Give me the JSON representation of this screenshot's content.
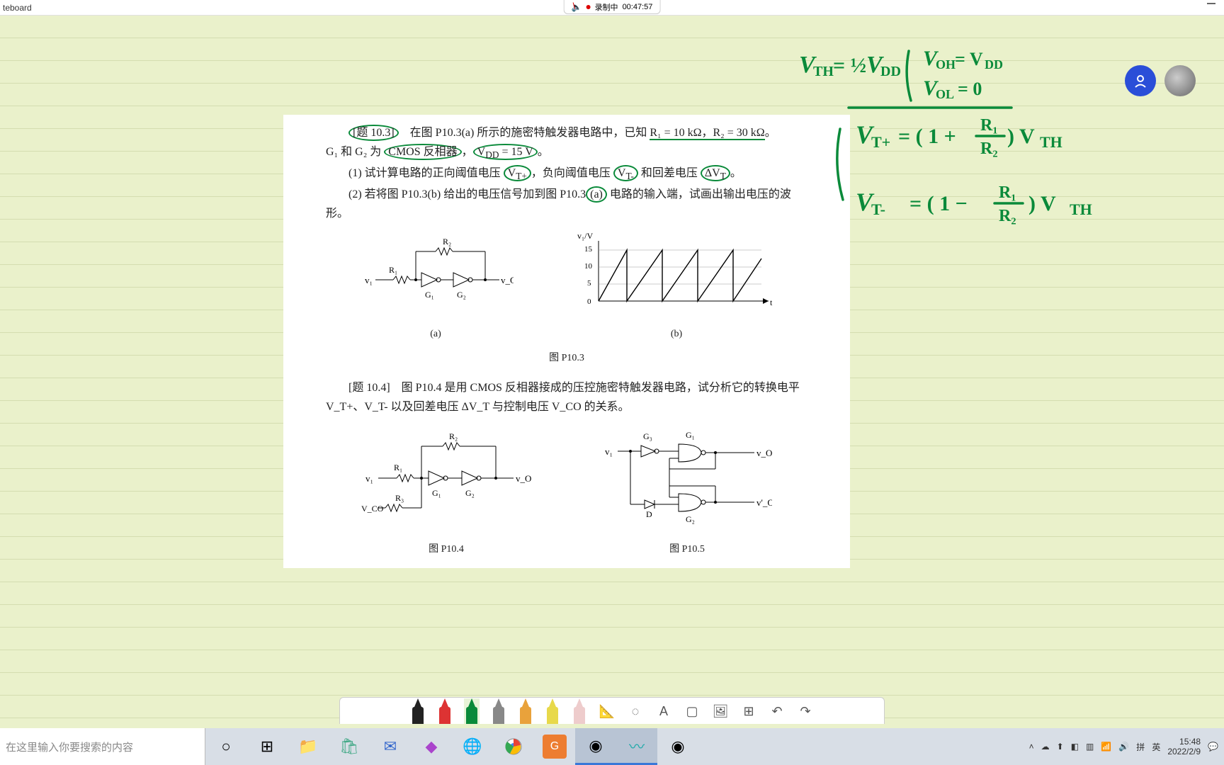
{
  "titlebar": {
    "title": "teboard"
  },
  "recording": {
    "audio_status": "muted",
    "label": "录制中",
    "time": "00:47:57"
  },
  "document": {
    "p103": {
      "intro": "[题 10.3]　在图 P10.3(a) 所示的施密特触发器电路中，已知 R₁ = 10 kΩ，R₂ = 30 kΩ。",
      "line2": "G₁ 和 G₂ 为 CMOS 反相器，V_DD = 15 V。",
      "item1": "(1) 试计算电路的正向阈值电压 V_T+，负向阈值电压 V_T- 和回差电压 ΔV_T。",
      "item2": "(2) 若将图 P10.3(b) 给出的电压信号加到图 P10.3(a) 电路的输入端，试画出输出电压的波形。",
      "fig_a": "(a)",
      "fig_b": "(b)",
      "caption": "图 P10.3",
      "circuit_labels": {
        "r1": "R₁",
        "r2": "R₂",
        "vi": "v₁",
        "vo": "v_O",
        "g1": "G₁",
        "g2": "G₂"
      },
      "wave": {
        "ylabel": "v₁/V",
        "xlabel": "t",
        "yticks": [
          "15",
          "10",
          "5",
          "0"
        ]
      }
    },
    "p104": {
      "intro": "[题 10.4]　图 P10.4 是用 CMOS 反相器接成的压控施密特触发器电路，试分析它的转换电平 V_T+、V_T- 以及回差电压 ΔV_T 与控制电压 V_CO 的关系。",
      "caption4": "图 P10.4",
      "caption5": "图 P10.5",
      "circuit4": {
        "r1": "R₁",
        "r2": "R₂",
        "r3": "R₃",
        "vi": "v₁",
        "vo": "v_O",
        "vco": "V_CO",
        "g1": "G₁",
        "g2": "G₂"
      },
      "circuit5": {
        "vi": "v₁",
        "vo": "v_O",
        "vo2": "v'_O",
        "g1": "G₁",
        "g2": "G₂",
        "g3": "G₃",
        "d": "D"
      }
    }
  },
  "handwriting": {
    "line1a": "V_TH = ½ V_DD",
    "line1b1": "V_OH = V_DD",
    "line1b2": "V_OL = 0",
    "line2": "V_T+ = (1 + R₁/R₂) V_TH",
    "line3": "V_T- = (1 − R₁/R₂) V_TH"
  },
  "toolbar": {
    "pens": [
      "black",
      "red",
      "green-active",
      "gray",
      "orange",
      "highlighter",
      "eraser",
      "ruler",
      "lasso",
      "text",
      "screen",
      "image",
      "add",
      "undo",
      "redo"
    ]
  },
  "taskbar": {
    "search_placeholder": "在这里输入你要搜索的内容",
    "apps": [
      "cortana",
      "taskview",
      "explorer",
      "store",
      "mail",
      "vs",
      "edge",
      "chrome",
      "wps",
      "obs-active",
      "whiteboard-active",
      "obs2"
    ],
    "tray": {
      "ime": "英",
      "time": "15:48",
      "date": "2022/2/9"
    }
  }
}
